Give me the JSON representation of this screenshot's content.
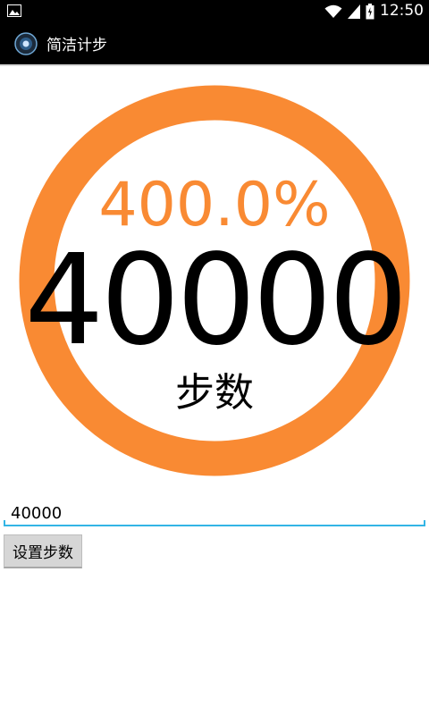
{
  "status_bar": {
    "time": "12:50",
    "icons": [
      "image-notification-icon",
      "wifi-icon",
      "signal-icon",
      "battery-icon"
    ]
  },
  "app_bar": {
    "title": "简洁计步",
    "icon": "app-logo-icon"
  },
  "progress": {
    "percent_text": "400.0%",
    "fraction": 4.0,
    "ring_color": "#f98a33"
  },
  "steps": {
    "count": "40000",
    "label": "步数"
  },
  "form": {
    "input_value": "40000",
    "button_label": "设置步数",
    "accent": "#33b5e5"
  }
}
